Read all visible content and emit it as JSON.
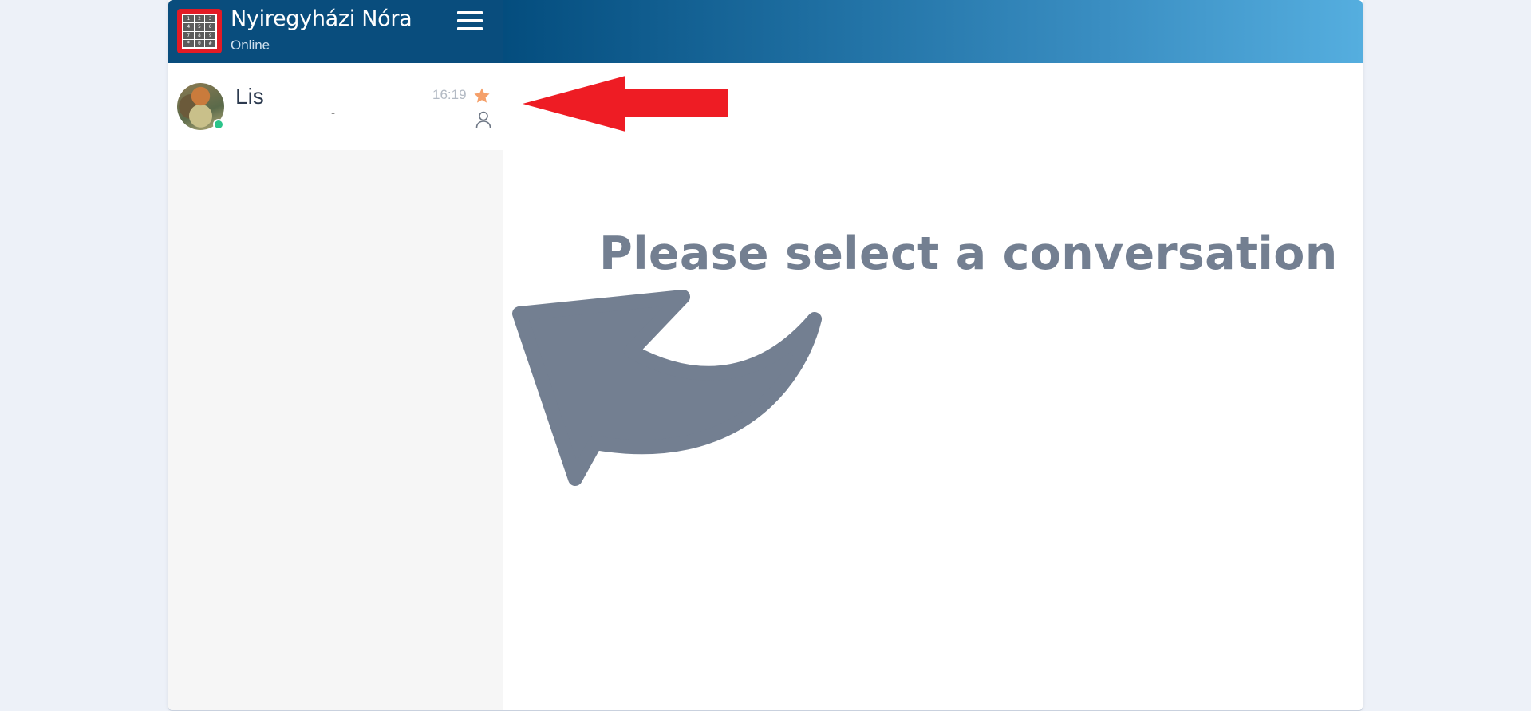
{
  "sidebar": {
    "header": {
      "user_name": "Nyiregyházi Nóra",
      "status": "Online",
      "logo_keys": [
        "1",
        "2",
        "3",
        "4",
        "5",
        "6",
        "7",
        "8",
        "9",
        "*",
        "0",
        "#"
      ]
    },
    "conversations": [
      {
        "name": "Lis",
        "preview": "-",
        "time": "16:19",
        "starred": true,
        "online": true
      }
    ]
  },
  "main": {
    "placeholder": "Please select a conversation"
  },
  "colors": {
    "header_dark": "#094d7d",
    "header_gradient_end": "#55aedf",
    "placeholder_text": "#737f91",
    "online_dot": "#2bc48a",
    "star": "#f5a06a",
    "red_arrow": "#ee1c24"
  },
  "icons": {
    "menu": "hamburger-menu-icon",
    "star": "star-icon",
    "user": "person-icon",
    "pointer": "curved-arrow-icon"
  }
}
